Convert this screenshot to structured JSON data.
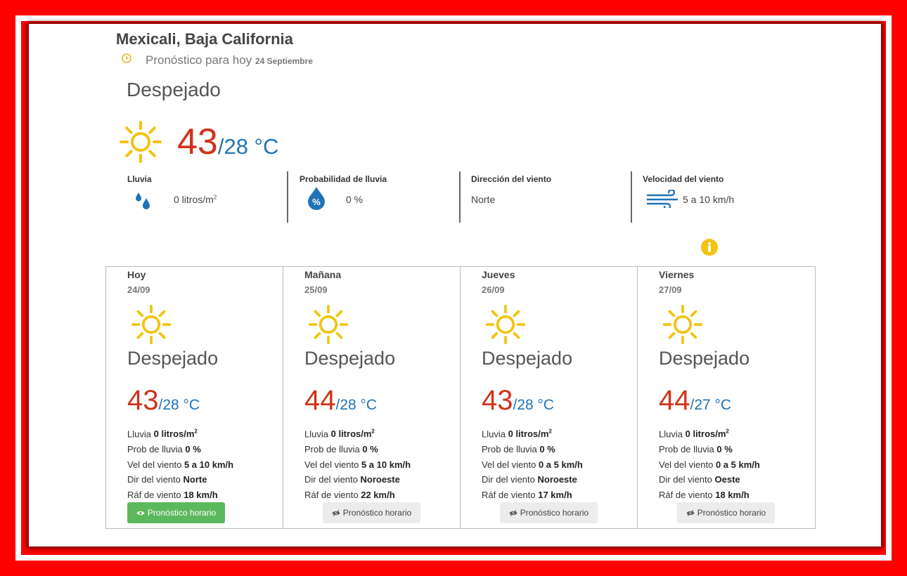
{
  "location": "Mexicali, Baja California",
  "subtitle": {
    "text": "Pronóstico para hoy",
    "date": "24 Septiembre"
  },
  "current": {
    "condition": "Despejado",
    "temp_max": "43",
    "temp_min": "/28 °C",
    "stats": [
      {
        "label": "Lluvia",
        "value": "0 litros/m",
        "sup": "2",
        "icon": "raindrops-icon"
      },
      {
        "label": "Probabilidad de lluvia",
        "value": "0 %",
        "icon": "percent-drop-icon"
      },
      {
        "label": "Dirección del viento",
        "value": "Norte"
      },
      {
        "label": "Velocidad del viento",
        "value": "5 a 10 km/h",
        "icon": "wind-icon"
      }
    ]
  },
  "labels": {
    "rain": "Lluvia",
    "rain_prob": "Prob de lluvia",
    "wind_speed": "Vel del viento",
    "wind_dir": "Dir del viento",
    "gust": "Ráf de viento",
    "button": "Pronóstico horario",
    "rain_unit": "litros/m",
    "rain_unit_sup": "2"
  },
  "days": [
    {
      "day": "Hoy",
      "date": "24/09",
      "condition": "Despejado",
      "max": "43",
      "min": "/28 °C",
      "rain": "0",
      "prob": "0 %",
      "wind": "5 a 10 km/h",
      "dir": "Norte",
      "gust": "18 km/h",
      "active": true
    },
    {
      "day": "Mañana",
      "date": "25/09",
      "condition": "Despejado",
      "max": "44",
      "min": "/28 °C",
      "rain": "0",
      "prob": "0 %",
      "wind": "5 a 10 km/h",
      "dir": "Noroeste",
      "gust": "22 km/h",
      "active": false
    },
    {
      "day": "Jueves",
      "date": "26/09",
      "condition": "Despejado",
      "max": "43",
      "min": "/28 °C",
      "rain": "0",
      "prob": "0 %",
      "wind": "0 a 5 km/h",
      "dir": "Noroeste",
      "gust": "17 km/h",
      "active": false
    },
    {
      "day": "Viernes",
      "date": "27/09",
      "condition": "Despejado",
      "max": "44",
      "min": "/27 °C",
      "rain": "0",
      "prob": "0 %",
      "wind": "0 a 5 km/h",
      "dir": "Oeste",
      "gust": "18 km/h",
      "active": false
    }
  ],
  "colors": {
    "max_temp": "#d0331a",
    "min_temp": "#1f73b7",
    "sun": "#f1c40f",
    "active_button": "#5cb85c",
    "info": "#f1c40f"
  }
}
